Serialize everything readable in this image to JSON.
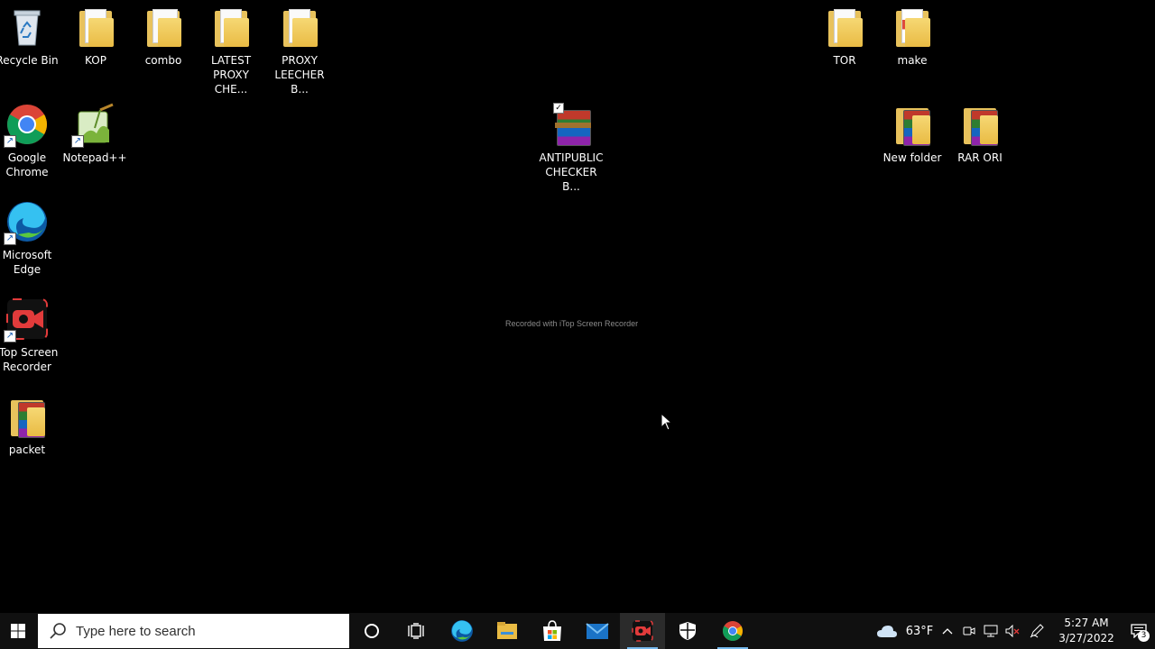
{
  "desktop": {
    "icons": [
      {
        "label": "Recycle Bin"
      },
      {
        "label": "KOP"
      },
      {
        "label": "combo"
      },
      {
        "label": "LATEST\nPROXY CHE..."
      },
      {
        "label": "PROXY\nLEECHER B..."
      },
      {
        "label": "TOR"
      },
      {
        "label": "make"
      },
      {
        "label": "Google\nChrome"
      },
      {
        "label": "Notepad++"
      },
      {
        "label": "ANTIPUBLIC\nCHECKER B..."
      },
      {
        "label": "New folder"
      },
      {
        "label": "RAR ORI"
      },
      {
        "label": "Microsoft\nEdge"
      },
      {
        "label": "iTop Screen\nRecorder"
      },
      {
        "label": "packet"
      }
    ],
    "watermark": "Recorded with iTop Screen Recorder"
  },
  "taskbar": {
    "search_placeholder": "Type here to search",
    "weather": "63°F",
    "time": "5:27 AM",
    "date": "3/27/2022",
    "notification_count": "3"
  },
  "colors": {
    "desktop_bg": "#000000",
    "taskbar_bg": "#101010",
    "folder": "#e9bb44",
    "accent": "#76b9ed"
  }
}
